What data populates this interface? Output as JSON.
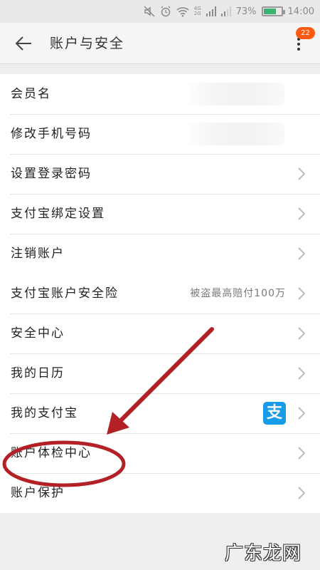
{
  "status_bar": {
    "network_label": "4G\n2G",
    "battery_percent": "73%",
    "battery_level": 0.73,
    "time": "14:00"
  },
  "app_bar": {
    "title": "账户与安全",
    "back_icon": "back-arrow-icon",
    "more_icon": "more-vertical-icon",
    "badge_count": "22"
  },
  "group1": {
    "items": [
      {
        "label": "会员名",
        "value_blurred": true
      },
      {
        "label": "修改手机号码",
        "value_blurred": true
      },
      {
        "label": "设置登录密码"
      },
      {
        "label": "支付宝绑定设置"
      },
      {
        "label": "注销账户"
      }
    ]
  },
  "group2": {
    "items": [
      {
        "label": "支付宝账户安全险",
        "right_text": "被盗最高赔付100万"
      },
      {
        "label": "安全中心"
      },
      {
        "label": "我的日历"
      },
      {
        "label": "我的支付宝",
        "icon": "alipay-icon",
        "icon_glyph": "支"
      },
      {
        "label": "账户体检中心"
      },
      {
        "label": "账户保护"
      }
    ]
  },
  "annotation": {
    "color": "#b32025",
    "highlighted_item": "账户体检中心"
  },
  "watermark": {
    "text": "广东龙网"
  },
  "colors": {
    "badge": "#ff5a12",
    "alipay_blue": "#1a9be9",
    "battery_green": "#3cb371"
  }
}
